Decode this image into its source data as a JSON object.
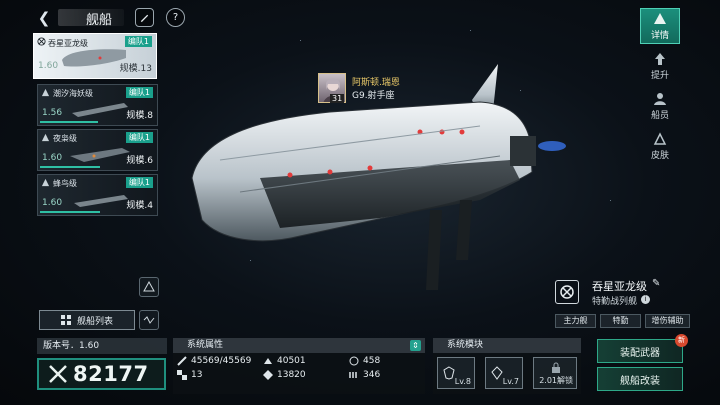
{
  "header": {
    "title": "舰船"
  },
  "ship_list": [
    {
      "name": "吞星亚龙级",
      "fleet": "编队1",
      "score": "1.60",
      "scale": "规模.13",
      "selected": true
    },
    {
      "name": "潮汐海妖级",
      "fleet": "编队1",
      "score": "1.56",
      "scale": "规模.8",
      "selected": false
    },
    {
      "name": "夜枭级",
      "fleet": "编队1",
      "score": "1.60",
      "scale": "规模.6",
      "selected": false
    },
    {
      "name": "蜂鸟级",
      "fleet": "编队1",
      "score": "1.60",
      "scale": "规模.4",
      "selected": false
    }
  ],
  "fleet_list_button": "舰船列表",
  "version": "版本号．1.60",
  "power": "82177",
  "attributes": {
    "title": "系统属性",
    "items": [
      "45569/45569",
      "40501",
      "458",
      "13",
      "13820",
      "346"
    ]
  },
  "modules": {
    "title": "系统模块",
    "slots": [
      "Lv.8",
      "Lv.7",
      "2.01解锁"
    ]
  },
  "actions": {
    "equip": "装配武器",
    "refit": "舰船改装",
    "new_badge": "新"
  },
  "right_tabs": [
    {
      "label": "详情",
      "icon": "ship-detail-icon",
      "active": true
    },
    {
      "label": "提升",
      "icon": "upgrade-icon",
      "active": false
    },
    {
      "label": "船员",
      "icon": "crew-icon",
      "active": false
    },
    {
      "label": "皮肤",
      "icon": "skin-icon",
      "active": false
    }
  ],
  "ship_info": {
    "name": "吞星亚龙级",
    "role": "特勤战列舰",
    "tags": [
      "主力舰",
      "特勤",
      "增伤辅助"
    ]
  },
  "captain": {
    "name": "阿斯顿.瑞恩",
    "position": "G9.射手座",
    "level": "31"
  },
  "colors": {
    "accent": "#1aa08c",
    "badge": "#d8492e"
  }
}
